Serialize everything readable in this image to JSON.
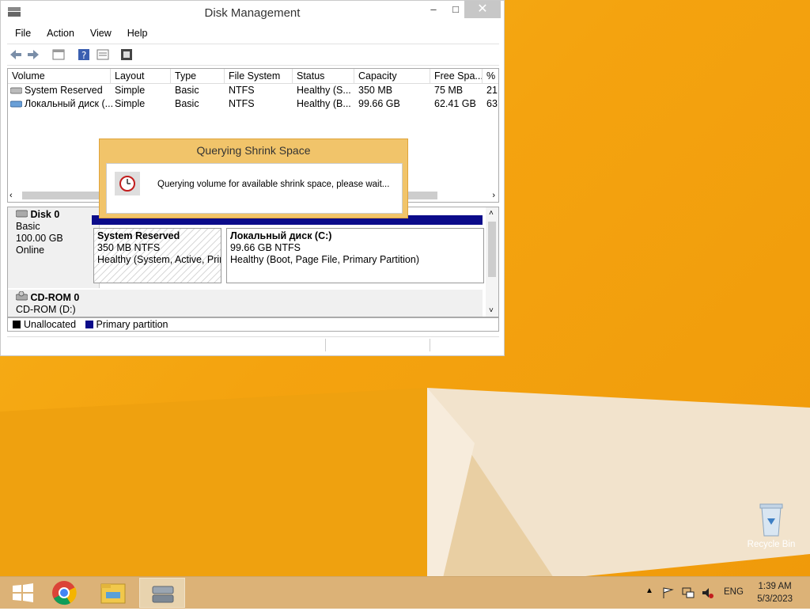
{
  "window": {
    "title": "Disk Management",
    "controls": {
      "minimize": "–",
      "maximize": "□",
      "close": "✕"
    }
  },
  "menu": [
    "File",
    "Action",
    "View",
    "Help"
  ],
  "volume_list": {
    "columns": [
      "Volume",
      "Layout",
      "Type",
      "File System",
      "Status",
      "Capacity",
      "Free Spa...",
      "% F"
    ],
    "rows": [
      [
        "System Reserved",
        "Simple",
        "Basic",
        "NTFS",
        "Healthy (S...",
        "350 MB",
        "75 MB",
        "21"
      ],
      [
        "Локальный диск (...",
        "Simple",
        "Basic",
        "NTFS",
        "Healthy (B...",
        "99.66 GB",
        "62.41 GB",
        "63"
      ]
    ]
  },
  "disks": [
    {
      "name": "Disk 0",
      "type": "Basic",
      "size": "100.00 GB",
      "state": "Online",
      "partitions": [
        {
          "name": "System Reserved",
          "size": "350 MB NTFS",
          "status": "Healthy (System, Active, Prin"
        },
        {
          "name": "Локальный диск  (C:)",
          "size": "99.66 GB NTFS",
          "status": "Healthy (Boot, Page File, Primary Partition)"
        }
      ]
    },
    {
      "name": "CD-ROM 0",
      "type": "CD-ROM (D:)"
    }
  ],
  "legend": [
    {
      "label": "Unallocated",
      "color": "#000000"
    },
    {
      "label": "Primary partition",
      "color": "#0b0b8a"
    }
  ],
  "dialog": {
    "title": "Querying Shrink Space",
    "message": "Querying volume for available shrink space, please wait..."
  },
  "desktop": {
    "recycle_bin_label": "Recycle Bin"
  },
  "taskbar": {
    "apps": [
      "start-icon",
      "chrome-icon",
      "file-explorer-icon",
      "disk-management-icon"
    ],
    "language": "ENG",
    "time": "1:39 AM",
    "date": "5/3/2023"
  },
  "colors": {
    "accent": "#f4a30f",
    "dialog": "#f1c46a",
    "taskbar": "#dcb277",
    "primary_partition": "#0b0b8a"
  }
}
